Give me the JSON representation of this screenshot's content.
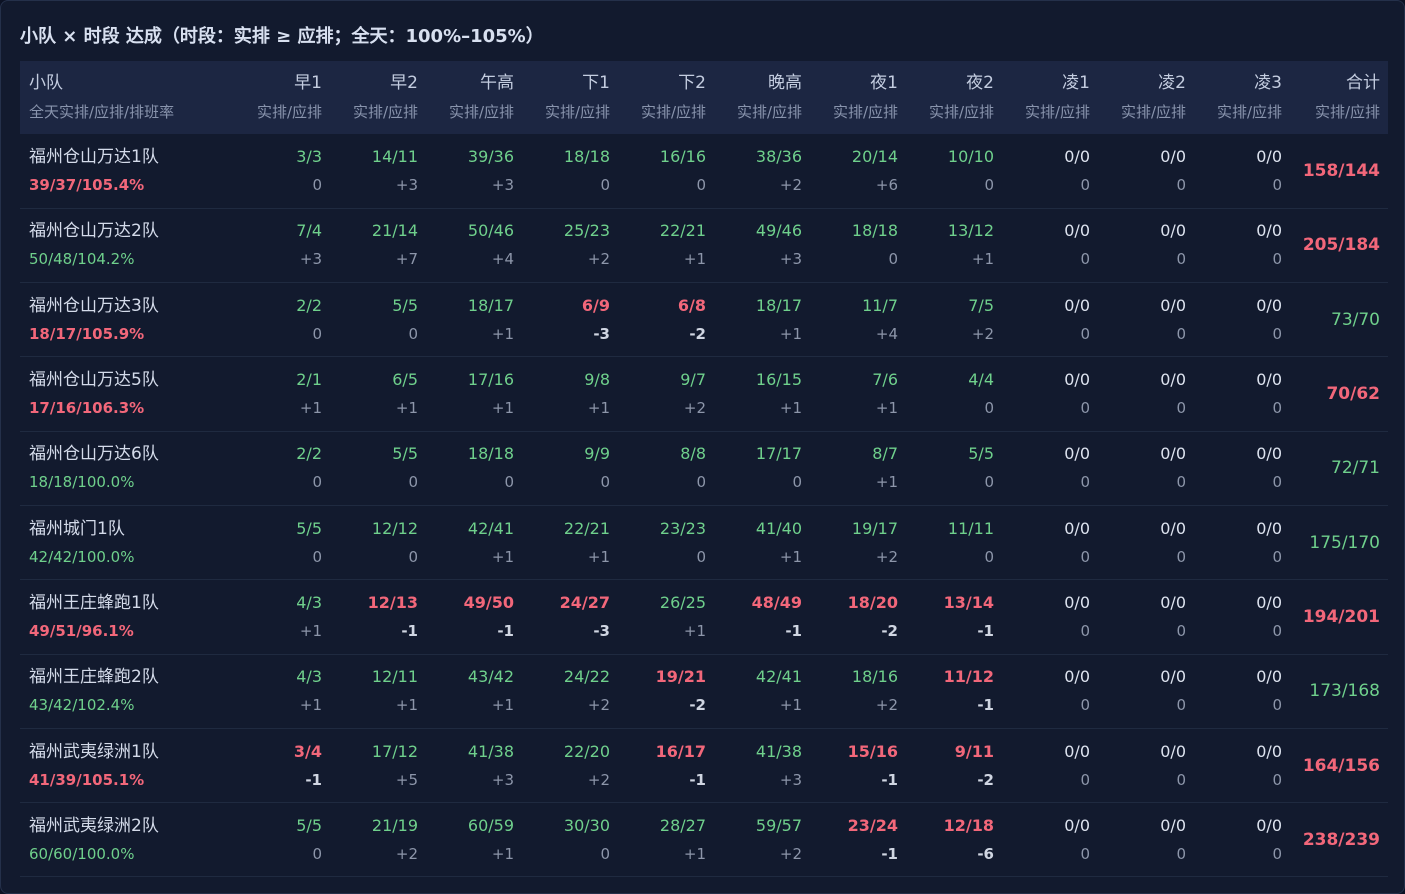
{
  "title": "小队 × 时段 达成（时段：实排 ≥ 应排；全天：100%–105%）",
  "colors": {
    "ok": "#6fd08c",
    "bad": "#f2677a",
    "neutral": "#dde3ef",
    "muted": "#8d96aa"
  },
  "header": {
    "team_label": "小队",
    "team_sub": "全天实排/应排/排班率",
    "slot_sub": "实排/应排",
    "slots": [
      "早1",
      "早2",
      "午高",
      "下1",
      "下2",
      "晚高",
      "夜1",
      "夜2",
      "凌1",
      "凌2",
      "凌3"
    ],
    "total_label": "合计"
  },
  "rows": [
    {
      "name": "福州仓山万达1队",
      "rate": "39/37/105.4%",
      "rate_status": "bad",
      "cells": [
        [
          "3/3",
          "0"
        ],
        [
          "14/11",
          "+3"
        ],
        [
          "39/36",
          "+3"
        ],
        [
          "18/18",
          "0"
        ],
        [
          "16/16",
          "0"
        ],
        [
          "38/36",
          "+2"
        ],
        [
          "20/14",
          "+6"
        ],
        [
          "10/10",
          "0"
        ],
        [
          "0/0",
          "0"
        ],
        [
          "0/0",
          "0"
        ],
        [
          "0/0",
          "0"
        ]
      ],
      "total": "158/144",
      "total_status": "bad"
    },
    {
      "name": "福州仓山万达2队",
      "rate": "50/48/104.2%",
      "rate_status": "ok",
      "cells": [
        [
          "7/4",
          "+3"
        ],
        [
          "21/14",
          "+7"
        ],
        [
          "50/46",
          "+4"
        ],
        [
          "25/23",
          "+2"
        ],
        [
          "22/21",
          "+1"
        ],
        [
          "49/46",
          "+3"
        ],
        [
          "18/18",
          "0"
        ],
        [
          "13/12",
          "+1"
        ],
        [
          "0/0",
          "0"
        ],
        [
          "0/0",
          "0"
        ],
        [
          "0/0",
          "0"
        ]
      ],
      "total": "205/184",
      "total_status": "bad"
    },
    {
      "name": "福州仓山万达3队",
      "rate": "18/17/105.9%",
      "rate_status": "bad",
      "cells": [
        [
          "2/2",
          "0"
        ],
        [
          "5/5",
          "0"
        ],
        [
          "18/17",
          "+1"
        ],
        [
          "6/9",
          "-3"
        ],
        [
          "6/8",
          "-2"
        ],
        [
          "18/17",
          "+1"
        ],
        [
          "11/7",
          "+4"
        ],
        [
          "7/5",
          "+2"
        ],
        [
          "0/0",
          "0"
        ],
        [
          "0/0",
          "0"
        ],
        [
          "0/0",
          "0"
        ]
      ],
      "total": "73/70",
      "total_status": "ok"
    },
    {
      "name": "福州仓山万达5队",
      "rate": "17/16/106.3%",
      "rate_status": "bad",
      "cells": [
        [
          "2/1",
          "+1"
        ],
        [
          "6/5",
          "+1"
        ],
        [
          "17/16",
          "+1"
        ],
        [
          "9/8",
          "+1"
        ],
        [
          "9/7",
          "+2"
        ],
        [
          "16/15",
          "+1"
        ],
        [
          "7/6",
          "+1"
        ],
        [
          "4/4",
          "0"
        ],
        [
          "0/0",
          "0"
        ],
        [
          "0/0",
          "0"
        ],
        [
          "0/0",
          "0"
        ]
      ],
      "total": "70/62",
      "total_status": "bad"
    },
    {
      "name": "福州仓山万达6队",
      "rate": "18/18/100.0%",
      "rate_status": "ok",
      "cells": [
        [
          "2/2",
          "0"
        ],
        [
          "5/5",
          "0"
        ],
        [
          "18/18",
          "0"
        ],
        [
          "9/9",
          "0"
        ],
        [
          "8/8",
          "0"
        ],
        [
          "17/17",
          "0"
        ],
        [
          "8/7",
          "+1"
        ],
        [
          "5/5",
          "0"
        ],
        [
          "0/0",
          "0"
        ],
        [
          "0/0",
          "0"
        ],
        [
          "0/0",
          "0"
        ]
      ],
      "total": "72/71",
      "total_status": "ok"
    },
    {
      "name": "福州城门1队",
      "rate": "42/42/100.0%",
      "rate_status": "ok",
      "cells": [
        [
          "5/5",
          "0"
        ],
        [
          "12/12",
          "0"
        ],
        [
          "42/41",
          "+1"
        ],
        [
          "22/21",
          "+1"
        ],
        [
          "23/23",
          "0"
        ],
        [
          "41/40",
          "+1"
        ],
        [
          "19/17",
          "+2"
        ],
        [
          "11/11",
          "0"
        ],
        [
          "0/0",
          "0"
        ],
        [
          "0/0",
          "0"
        ],
        [
          "0/0",
          "0"
        ]
      ],
      "total": "175/170",
      "total_status": "ok"
    },
    {
      "name": "福州王庄蜂跑1队",
      "rate": "49/51/96.1%",
      "rate_status": "bad",
      "cells": [
        [
          "4/3",
          "+1"
        ],
        [
          "12/13",
          "-1"
        ],
        [
          "49/50",
          "-1"
        ],
        [
          "24/27",
          "-3"
        ],
        [
          "26/25",
          "+1"
        ],
        [
          "48/49",
          "-1"
        ],
        [
          "18/20",
          "-2"
        ],
        [
          "13/14",
          "-1"
        ],
        [
          "0/0",
          "0"
        ],
        [
          "0/0",
          "0"
        ],
        [
          "0/0",
          "0"
        ]
      ],
      "total": "194/201",
      "total_status": "bad"
    },
    {
      "name": "福州王庄蜂跑2队",
      "rate": "43/42/102.4%",
      "rate_status": "ok",
      "cells": [
        [
          "4/3",
          "+1"
        ],
        [
          "12/11",
          "+1"
        ],
        [
          "43/42",
          "+1"
        ],
        [
          "24/22",
          "+2"
        ],
        [
          "19/21",
          "-2"
        ],
        [
          "42/41",
          "+1"
        ],
        [
          "18/16",
          "+2"
        ],
        [
          "11/12",
          "-1"
        ],
        [
          "0/0",
          "0"
        ],
        [
          "0/0",
          "0"
        ],
        [
          "0/0",
          "0"
        ]
      ],
      "total": "173/168",
      "total_status": "ok"
    },
    {
      "name": "福州武夷绿洲1队",
      "rate": "41/39/105.1%",
      "rate_status": "bad",
      "cells": [
        [
          "3/4",
          "-1"
        ],
        [
          "17/12",
          "+5"
        ],
        [
          "41/38",
          "+3"
        ],
        [
          "22/20",
          "+2"
        ],
        [
          "16/17",
          "-1"
        ],
        [
          "41/38",
          "+3"
        ],
        [
          "15/16",
          "-1"
        ],
        [
          "9/11",
          "-2"
        ],
        [
          "0/0",
          "0"
        ],
        [
          "0/0",
          "0"
        ],
        [
          "0/0",
          "0"
        ]
      ],
      "total": "164/156",
      "total_status": "bad"
    },
    {
      "name": "福州武夷绿洲2队",
      "rate": "60/60/100.0%",
      "rate_status": "ok",
      "cells": [
        [
          "5/5",
          "0"
        ],
        [
          "21/19",
          "+2"
        ],
        [
          "60/59",
          "+1"
        ],
        [
          "30/30",
          "0"
        ],
        [
          "28/27",
          "+1"
        ],
        [
          "59/57",
          "+2"
        ],
        [
          "23/24",
          "-1"
        ],
        [
          "12/18",
          "-6"
        ],
        [
          "0/0",
          "0"
        ],
        [
          "0/0",
          "0"
        ],
        [
          "0/0",
          "0"
        ]
      ],
      "total": "238/239",
      "total_status": "bad"
    }
  ]
}
